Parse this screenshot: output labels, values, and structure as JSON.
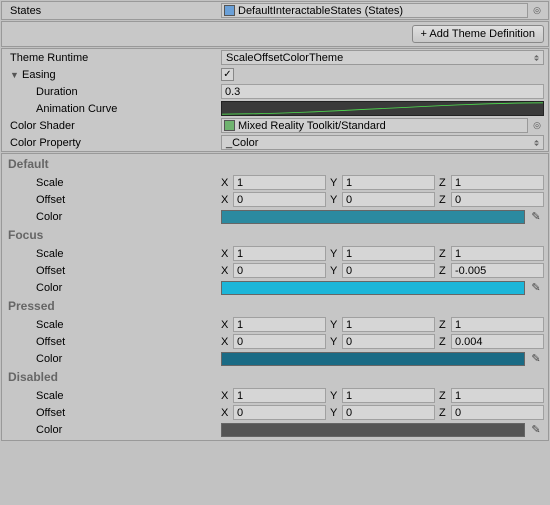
{
  "top": {
    "states_label": "States",
    "states_value": "DefaultInteractableStates (States)"
  },
  "buttons": {
    "add_theme": "+ Add Theme Definition"
  },
  "theme": {
    "runtime_label": "Theme Runtime",
    "runtime_value": "ScaleOffsetColorTheme",
    "easing_label": "Easing",
    "duration_label": "Duration",
    "duration_value": "0.3",
    "animcurve_label": "Animation Curve",
    "shader_label": "Color Shader",
    "shader_value": "Mixed Reality Toolkit/Standard",
    "colorprop_label": "Color Property",
    "colorprop_value": "_Color"
  },
  "axis": {
    "x": "X",
    "y": "Y",
    "z": "Z"
  },
  "labels": {
    "scale": "Scale",
    "offset": "Offset",
    "color": "Color",
    "check": "✓"
  },
  "states": {
    "default": {
      "name": "Default",
      "scale": {
        "x": "1",
        "y": "1",
        "z": "1"
      },
      "offset": {
        "x": "0",
        "y": "0",
        "z": "0"
      },
      "color": "#2b8aa0"
    },
    "focus": {
      "name": "Focus",
      "scale": {
        "x": "1",
        "y": "1",
        "z": "1"
      },
      "offset": {
        "x": "0",
        "y": "0",
        "z": "-0.005"
      },
      "color": "#1cb6d9"
    },
    "pressed": {
      "name": "Pressed",
      "scale": {
        "x": "1",
        "y": "1",
        "z": "1"
      },
      "offset": {
        "x": "0",
        "y": "0",
        "z": "0.004"
      },
      "color": "#1a6b85"
    },
    "disabled": {
      "name": "Disabled",
      "scale": {
        "x": "1",
        "y": "1",
        "z": "1"
      },
      "offset": {
        "x": "0",
        "y": "0",
        "z": "0"
      },
      "color": "#555555"
    }
  }
}
